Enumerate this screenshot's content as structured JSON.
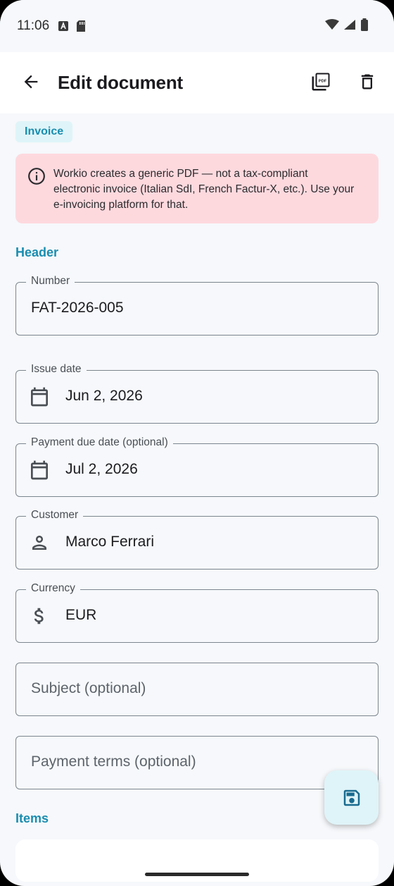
{
  "status_bar": {
    "time": "11:06"
  },
  "app_bar": {
    "title": "Edit document"
  },
  "doc_type_chip": "Invoice",
  "alert": {
    "text": "Workio creates a generic PDF — not a tax-compliant electronic invoice (Italian SdI, French Factur-X, etc.). Use your e-invoicing platform for that."
  },
  "sections": {
    "header": "Header",
    "items": "Items"
  },
  "fields": {
    "number": {
      "label": "Number",
      "value": "FAT-2026-005"
    },
    "issue_date": {
      "label": "Issue date",
      "value": "Jun 2, 2026"
    },
    "due_date": {
      "label": "Payment due date (optional)",
      "value": "Jul 2, 2026"
    },
    "customer": {
      "label": "Customer",
      "value": "Marco Ferrari"
    },
    "currency": {
      "label": "Currency",
      "value": "EUR"
    },
    "subject": {
      "placeholder": "Subject (optional)"
    },
    "payment_terms": {
      "placeholder": "Payment terms (optional)"
    }
  },
  "colors": {
    "accent": "#1a8db0",
    "alert_bg": "#fdd9de",
    "chip_bg": "#dff4f8"
  },
  "icons": [
    "back-arrow-icon",
    "pdf-icon",
    "trash-icon",
    "info-icon",
    "calendar-icon",
    "person-icon",
    "dollar-icon",
    "save-icon"
  ]
}
